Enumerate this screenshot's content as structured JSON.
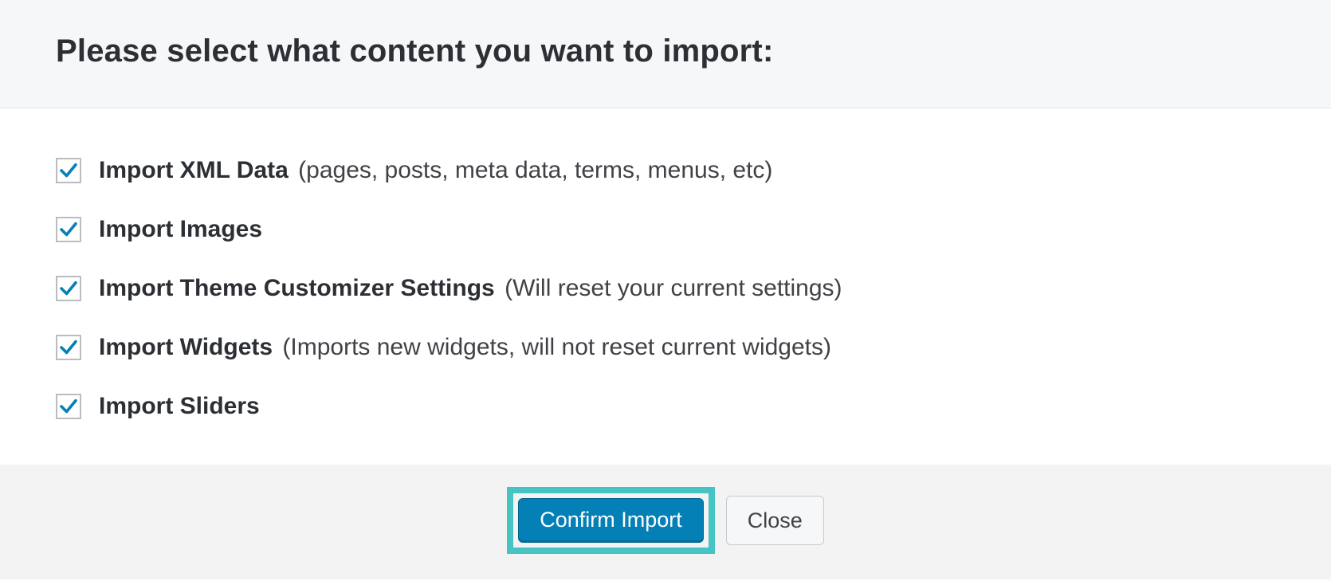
{
  "header": {
    "title": "Please select what content you want to import:"
  },
  "options": [
    {
      "label": "Import XML Data",
      "hint": "(pages, posts, meta data, terms, menus, etc)",
      "checked": true,
      "name": "option-xml-data"
    },
    {
      "label": "Import Images",
      "hint": "",
      "checked": true,
      "name": "option-images"
    },
    {
      "label": "Import Theme Customizer Settings",
      "hint": "(Will reset your current settings)",
      "checked": true,
      "name": "option-customizer"
    },
    {
      "label": "Import Widgets",
      "hint": "(Imports new widgets, will not reset current widgets)",
      "checked": true,
      "name": "option-widgets"
    },
    {
      "label": "Import Sliders",
      "hint": "",
      "checked": true,
      "name": "option-sliders"
    }
  ],
  "footer": {
    "confirm_label": "Confirm Import",
    "close_label": "Close"
  }
}
